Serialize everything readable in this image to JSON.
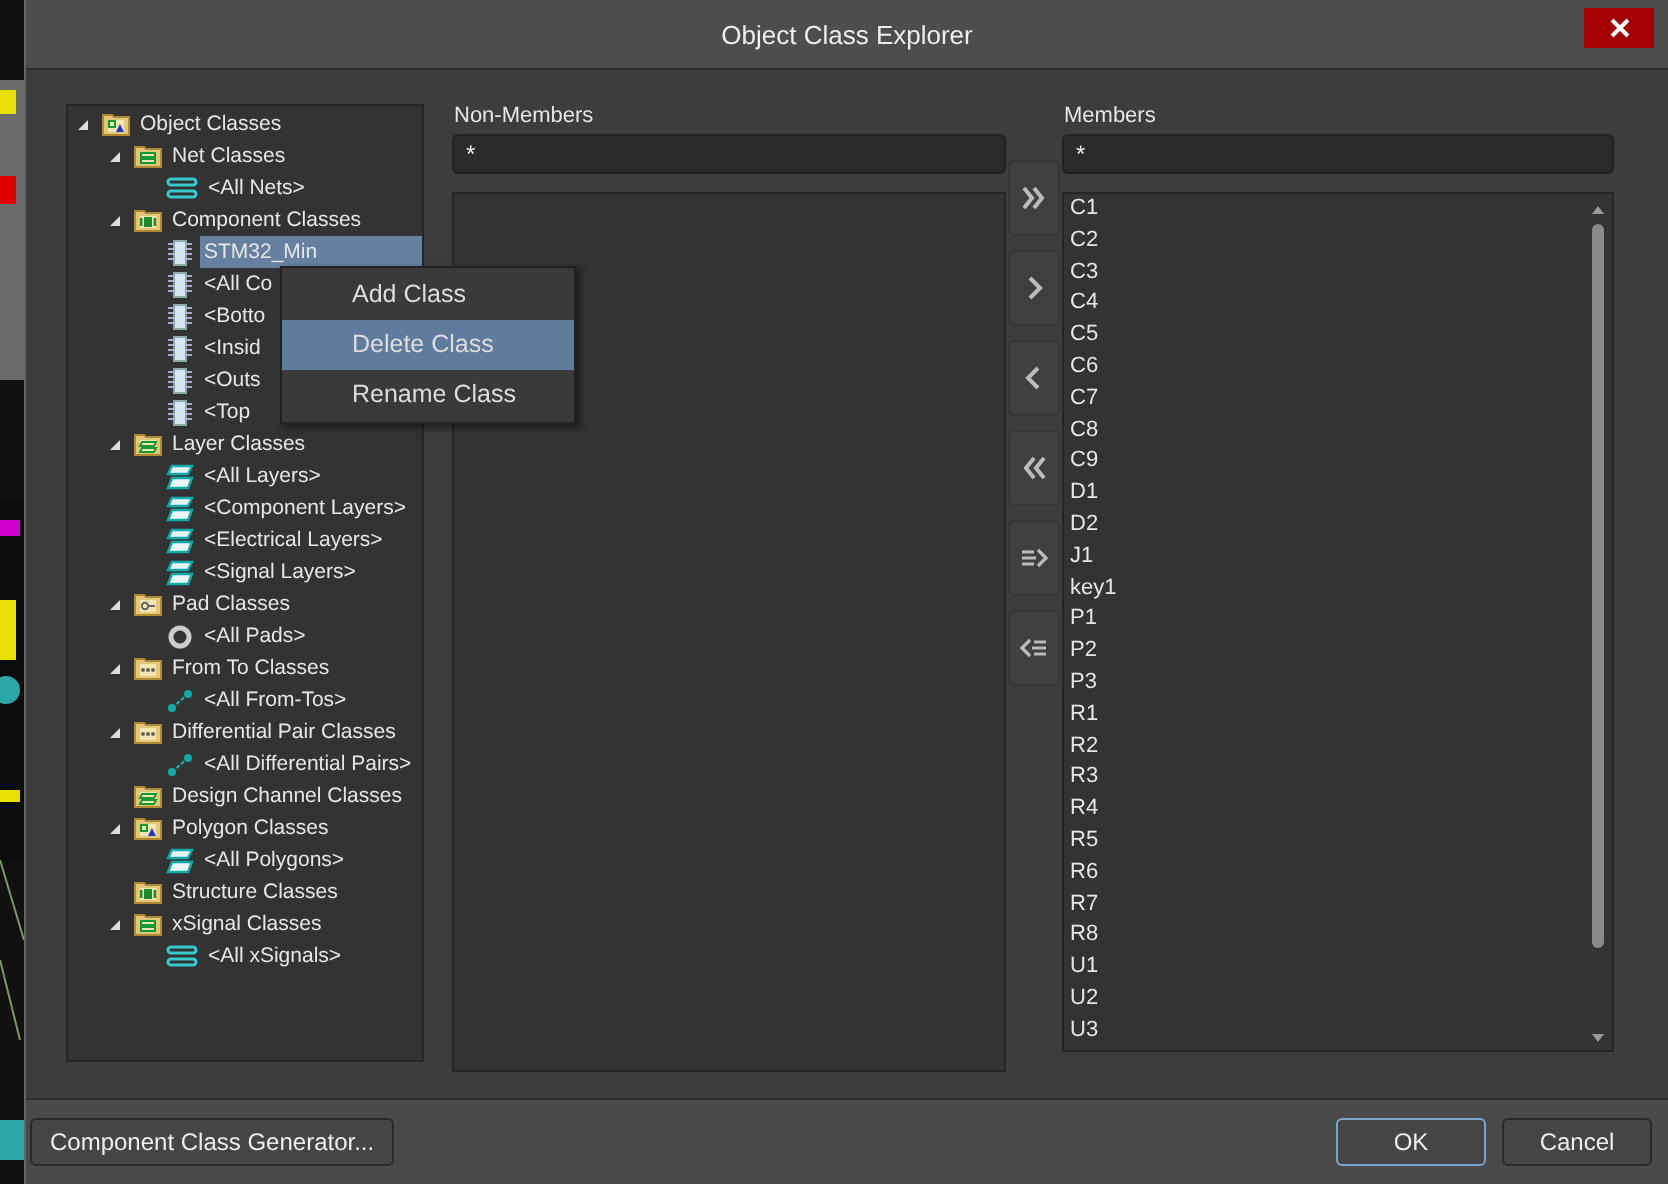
{
  "window": {
    "title": "Object Class Explorer"
  },
  "tree": [
    {
      "label": "Object Classes",
      "kind": "folder-polygon",
      "expanded": true,
      "selected": false,
      "children": [
        {
          "label": "Net Classes",
          "kind": "folder-net",
          "expanded": true,
          "selected": false,
          "children": [
            {
              "label": "<All Nets>",
              "kind": "net",
              "selected": false
            }
          ]
        },
        {
          "label": "Component Classes",
          "kind": "folder-chip",
          "expanded": true,
          "selected": false,
          "children": [
            {
              "label": "STM32_Min",
              "kind": "chip",
              "selected": true
            },
            {
              "label": "<All Co",
              "kind": "chip",
              "selected": false
            },
            {
              "label": "<Botto",
              "kind": "chip",
              "selected": false
            },
            {
              "label": "<Insid",
              "kind": "chip",
              "selected": false
            },
            {
              "label": "<Outs",
              "kind": "chip",
              "selected": false
            },
            {
              "label": "<Top",
              "kind": "chip",
              "selected": false
            }
          ]
        },
        {
          "label": "Layer Classes",
          "kind": "folder-layer",
          "expanded": true,
          "selected": false,
          "children": [
            {
              "label": "<All Layers>",
              "kind": "layer",
              "selected": false
            },
            {
              "label": "<Component Layers>",
              "kind": "layer",
              "selected": false
            },
            {
              "label": "<Electrical Layers>",
              "kind": "layer",
              "selected": false
            },
            {
              "label": "<Signal Layers>",
              "kind": "layer",
              "selected": false
            }
          ]
        },
        {
          "label": "Pad Classes",
          "kind": "folder-pad",
          "expanded": true,
          "selected": false,
          "children": [
            {
              "label": "<All Pads>",
              "kind": "pad",
              "selected": false
            }
          ]
        },
        {
          "label": "From To Classes",
          "kind": "folder-dots",
          "expanded": true,
          "selected": false,
          "children": [
            {
              "label": "<All From-Tos>",
              "kind": "fromto",
              "selected": false
            }
          ]
        },
        {
          "label": "Differential Pair Classes",
          "kind": "folder-dots",
          "expanded": true,
          "selected": false,
          "children": [
            {
              "label": "<All Differential Pairs>",
              "kind": "fromto",
              "selected": false
            }
          ]
        },
        {
          "label": "Design Channel Classes",
          "kind": "folder-layer",
          "selected": false
        },
        {
          "label": "Polygon Classes",
          "kind": "folder-polygon",
          "expanded": true,
          "selected": false,
          "children": [
            {
              "label": "<All Polygons>",
              "kind": "layer",
              "selected": false
            }
          ]
        },
        {
          "label": "Structure Classes",
          "kind": "folder-chip",
          "selected": false
        },
        {
          "label": "xSignal Classes",
          "kind": "folder-net",
          "expanded": true,
          "selected": false,
          "children": [
            {
              "label": "<All xSignals>",
              "kind": "net",
              "selected": false
            }
          ]
        }
      ]
    }
  ],
  "context_menu": [
    {
      "label": "Add Class",
      "selected": false
    },
    {
      "label": "Delete Class",
      "selected": true
    },
    {
      "label": "Rename Class",
      "selected": false
    }
  ],
  "non_members": {
    "label": "Non-Members",
    "filter": "*"
  },
  "move_buttons": [
    {
      "kind": "add-all"
    },
    {
      "kind": "add"
    },
    {
      "kind": "remove"
    },
    {
      "kind": "remove-all"
    },
    {
      "kind": "add-selected"
    },
    {
      "kind": "remove-selected"
    }
  ],
  "members": {
    "label": "Members",
    "filter": "*",
    "items": [
      "C1",
      "C2",
      "C3",
      "C4",
      "C5",
      "C6",
      "C7",
      "C8",
      "C9",
      "D1",
      "D2",
      "J1",
      "key1",
      "P1",
      "P2",
      "P3",
      "R1",
      "R2",
      "R3",
      "R4",
      "R5",
      "R6",
      "R7",
      "R8",
      "U1",
      "U2",
      "U3"
    ]
  },
  "footer_buttons": [
    {
      "label": "Component Class Generator...",
      "kind": "left"
    },
    {
      "label": "OK",
      "kind": "default"
    },
    {
      "label": "Cancel",
      "kind": "normal"
    }
  ]
}
